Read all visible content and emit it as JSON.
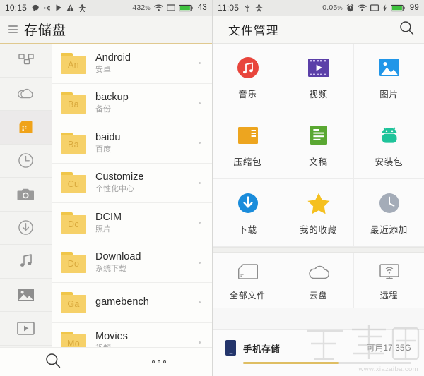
{
  "left_phone": {
    "status_bar": {
      "clock": "10:15",
      "left_icons": [
        "chat-bubble-icon",
        "usb-icon",
        "play-icon",
        "warning-icon",
        "people-icon"
      ],
      "data_rate": "432",
      "data_rate_unit": "%",
      "right_icons": [
        "wifi-icon",
        "sim-icon",
        "battery-icon"
      ],
      "battery_level": "43"
    },
    "title": "存储盘",
    "menu_icon": "hamburger-icon",
    "sidebar": [
      {
        "name": "categories",
        "icon": "grid-squares-icon",
        "active": false
      },
      {
        "name": "cloud",
        "icon": "cloud-icon",
        "active": false
      },
      {
        "name": "storage",
        "icon": "sdcard-icon",
        "active": true
      },
      {
        "name": "recent",
        "icon": "clock-icon",
        "active": false
      },
      {
        "name": "camera",
        "icon": "camera-icon",
        "active": false
      },
      {
        "name": "downloads",
        "icon": "download-circle-icon",
        "active": false
      },
      {
        "name": "music",
        "icon": "music-note-icon",
        "active": false
      },
      {
        "name": "pictures",
        "icon": "image-icon",
        "active": false
      },
      {
        "name": "videos",
        "icon": "video-play-icon",
        "active": false
      },
      {
        "name": "vr",
        "icon": "vr-folder-icon",
        "active": false
      }
    ],
    "files": [
      {
        "badge": "An",
        "name": "Android",
        "subtitle": "安卓"
      },
      {
        "badge": "Ba",
        "name": "backup",
        "subtitle": "备份"
      },
      {
        "badge": "Ba",
        "name": "baidu",
        "subtitle": "百度"
      },
      {
        "badge": "Cu",
        "name": "Customize",
        "subtitle": "个性化中心"
      },
      {
        "badge": "Dc",
        "name": "DCIM",
        "subtitle": "照片"
      },
      {
        "badge": "Do",
        "name": "Download",
        "subtitle": "系统下载"
      },
      {
        "badge": "Ga",
        "name": "gamebench",
        "subtitle": ""
      },
      {
        "badge": "Mo",
        "name": "Movies",
        "subtitle": "视频"
      }
    ],
    "bottom_bar": {
      "search_icon": "search-icon",
      "more_icon": "more-dots-icon"
    }
  },
  "right_phone": {
    "status_bar": {
      "clock": "11:05",
      "left_icons": [
        "usb-icon",
        "people-icon"
      ],
      "data_rate": "0.05",
      "data_rate_unit": "%",
      "right_icons": [
        "alarm-icon",
        "wifi-icon",
        "sim-icon",
        "charging-icon",
        "battery-icon"
      ],
      "battery_level": "99"
    },
    "title": "文件管理",
    "search_icon": "search-icon",
    "categories": [
      {
        "label": "音乐",
        "icon": "music-circle-icon",
        "color": "#e8453c"
      },
      {
        "label": "视频",
        "icon": "film-icon",
        "color": "#5b3fa8"
      },
      {
        "label": "图片",
        "icon": "picture-icon",
        "color": "#2196e8"
      },
      {
        "label": "压缩包",
        "icon": "archive-icon",
        "color": "#eda51f"
      },
      {
        "label": "文稿",
        "icon": "document-icon",
        "color": "#5aa832"
      },
      {
        "label": "安装包",
        "icon": "android-icon",
        "color": "#1fc39a"
      },
      {
        "label": "下载",
        "icon": "download-circle-icon",
        "color": "#1a8cdb"
      },
      {
        "label": "我的收藏",
        "icon": "star-icon",
        "color": "#f5c01f"
      },
      {
        "label": "最近添加",
        "icon": "clock-gray-icon",
        "color": "#a4acb8"
      }
    ],
    "sources": [
      {
        "label": "全部文件",
        "icon": "sdcard-outline-icon"
      },
      {
        "label": "云盘",
        "icon": "cloud-outline-icon"
      },
      {
        "label": "远程",
        "icon": "remote-monitor-icon"
      }
    ],
    "storage": {
      "icon": "phone-icon",
      "label": "手机存储",
      "free_text": "可用17.35G",
      "used_percent": 57,
      "bar_color": "#dfbe63"
    }
  },
  "watermark": {
    "logo_text": "下载吧",
    "url_text": "www.xiazaiba.com"
  }
}
